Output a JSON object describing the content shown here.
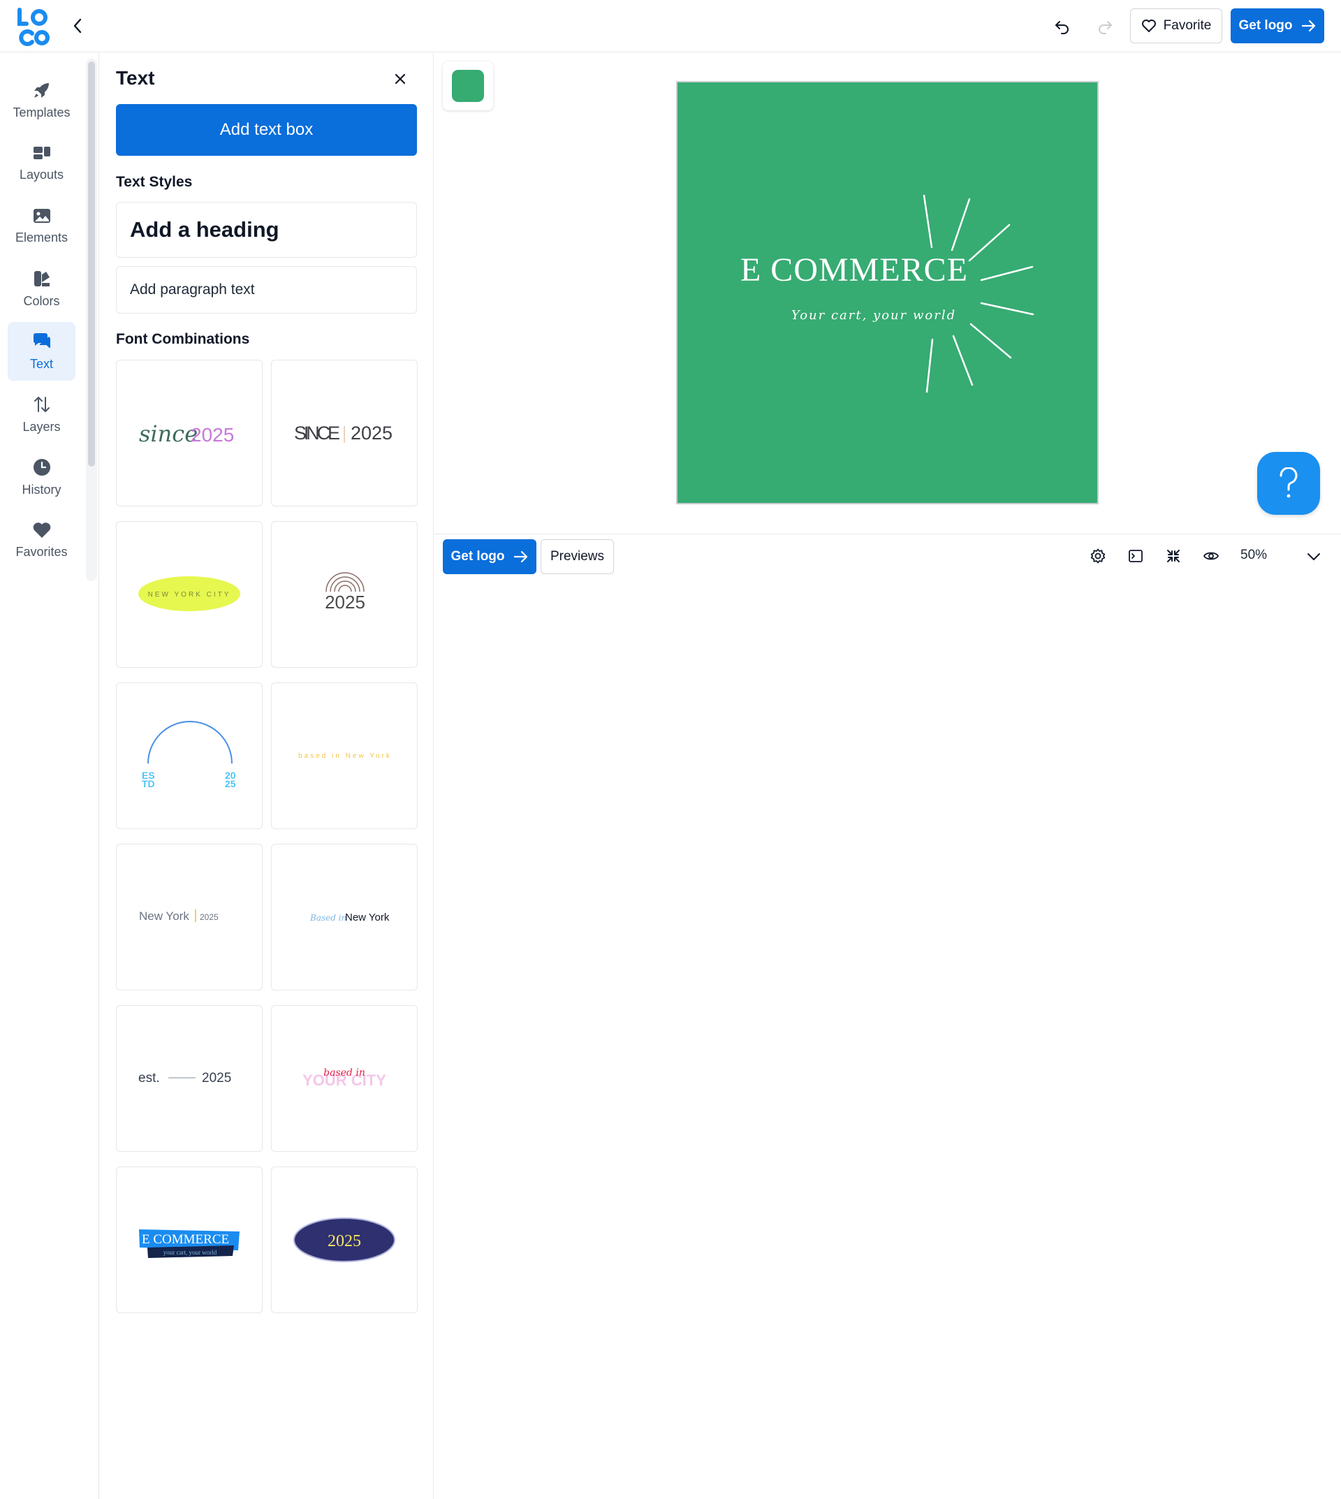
{
  "topbar": {
    "favorite_label": "Favorite",
    "get_logo_label": "Get logo"
  },
  "rail": {
    "items": [
      {
        "label": "Templates",
        "icon": "rocket-icon"
      },
      {
        "label": "Layouts",
        "icon": "layouts-icon"
      },
      {
        "label": "Elements",
        "icon": "image-icon"
      },
      {
        "label": "Colors",
        "icon": "palette-icon"
      },
      {
        "label": "Text",
        "icon": "chat-text-icon",
        "active": true
      },
      {
        "label": "Layers",
        "icon": "arrows-updown-icon"
      },
      {
        "label": "History",
        "icon": "clock-icon"
      },
      {
        "label": "Favorites",
        "icon": "heart-icon"
      }
    ]
  },
  "panel": {
    "title": "Text",
    "add_text_box": "Add text box",
    "text_styles_heading": "Text Styles",
    "heading_style": "Add a heading",
    "paragraph_style": "Add paragraph text",
    "font_combinations_heading": "Font Combinations",
    "combos": [
      {
        "texts": [
          "since",
          "2025"
        ]
      },
      {
        "texts": [
          "SINCE",
          "2025"
        ]
      },
      {
        "texts": [
          "NEW YORK CITY"
        ]
      },
      {
        "texts": [
          "2025"
        ]
      },
      {
        "texts": [
          "ES",
          "TD",
          "20",
          "25"
        ]
      },
      {
        "texts": [
          "based in New York"
        ]
      },
      {
        "texts": [
          "New York",
          "2025"
        ]
      },
      {
        "texts": [
          "Based in",
          "New York"
        ]
      },
      {
        "texts": [
          "est.",
          "2025"
        ]
      },
      {
        "texts": [
          "based in",
          "YOUR CITY"
        ]
      },
      {
        "texts": [
          "E COMMERCE",
          "your cart, your world"
        ]
      },
      {
        "texts": [
          "2025"
        ]
      }
    ]
  },
  "canvas": {
    "background_color": "#36ab72",
    "logo_title": "E COMMERCE",
    "logo_tagline": "Your cart, your world"
  },
  "bottombar": {
    "get_logo_label": "Get logo",
    "previews_label": "Previews",
    "zoom": "50%"
  },
  "colors": {
    "accent": "#0a6edb",
    "help_button": "#1a90f0",
    "active_rail_bg": "#e8f1fc"
  }
}
